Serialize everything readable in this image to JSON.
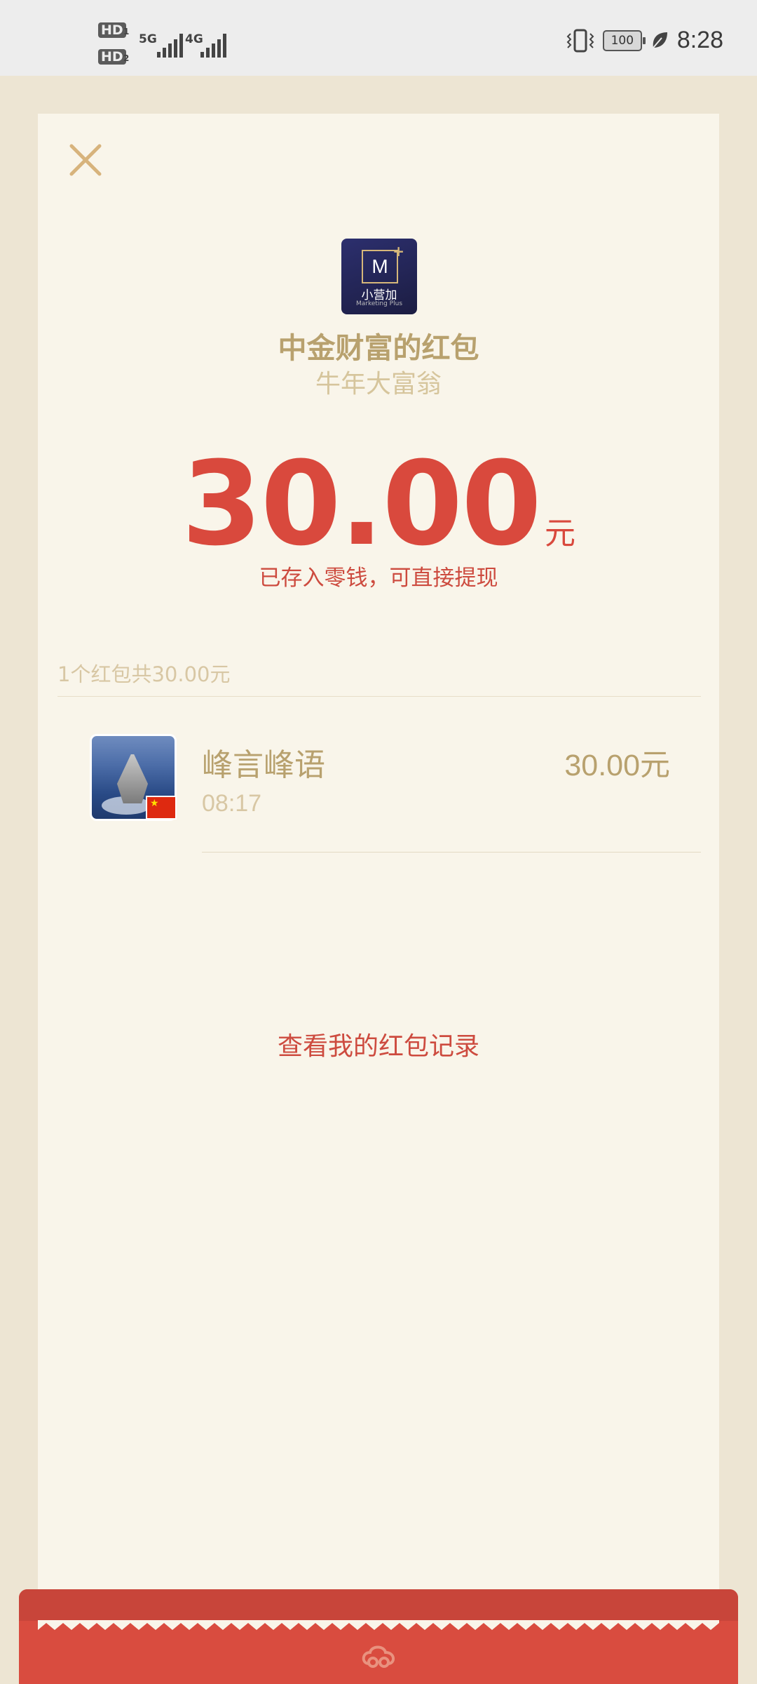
{
  "status_bar": {
    "sim1": "HD",
    "sim1_index": "1",
    "sim2": "HD",
    "sim2_index": "2",
    "net1": "5G",
    "net2": "4G",
    "battery": "100",
    "time": "8:28"
  },
  "packet": {
    "sender_logo_text": "M",
    "sender_logo_cn": "小营加",
    "sender_logo_en": "Marketing Plus",
    "title": "中金财富的红包",
    "subtitle": "牛年大富翁",
    "amount": "30.00",
    "unit": "元",
    "saved_note": "已存入零钱，可直接提现"
  },
  "summary": "1个红包共30.00元",
  "records": [
    {
      "name": "峰言峰语",
      "time": "08:17",
      "amount": "30.00元"
    }
  ],
  "history_link": "查看我的红包记录",
  "colors": {
    "accent_red": "#d9493d",
    "gold": "#b8a16e",
    "card_bg": "#f9f5ea",
    "page_bg": "#ede5d3"
  },
  "icons": {
    "close": "close-icon",
    "footer": "cloud-swirl-icon"
  }
}
